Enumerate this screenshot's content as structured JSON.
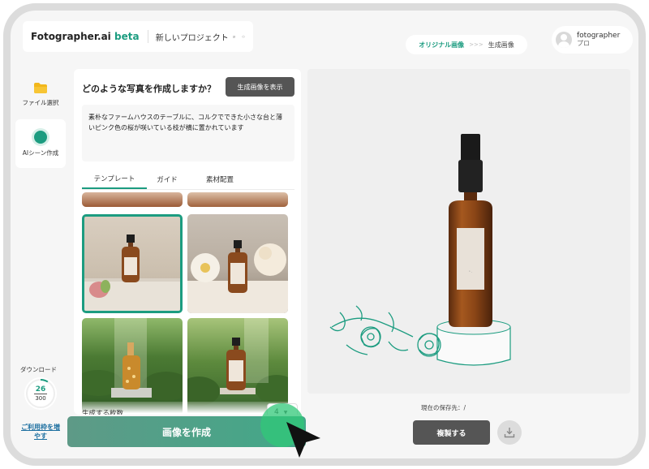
{
  "header": {
    "brand_name": "Fotographer.ai",
    "brand_tag": "beta",
    "project_name": "新しいプロジェクト",
    "view_toggle": {
      "original_label": "オリジナル画像",
      "generated_label": "生成画像"
    },
    "user": {
      "name": "fotographer",
      "plan": "プロ"
    }
  },
  "sidebar": {
    "items": [
      {
        "label": "ファイル選択",
        "icon": "folder-icon"
      },
      {
        "label": "AIシーン作成",
        "icon": "ai-scene-icon"
      }
    ],
    "download": {
      "label": "ダウンロード",
      "remaining": "26",
      "total": "300",
      "fraction": 0.087
    },
    "plan_link": "ご利用枠を増やす"
  },
  "panel": {
    "question": "どのような写真を作成しますか？",
    "show_generated_button": "生成画像を表示",
    "prompt_text": "素朴なファームハウスのテーブルに、コルクでできた小さな台と薄いピンク色の桜が咲いている枝が横に置かれています",
    "tabs": [
      {
        "label": "テンプレート",
        "active": true
      },
      {
        "label": "ガイド",
        "active": false
      },
      {
        "label": "素材配置",
        "active": false
      }
    ],
    "count_label": "生成する枚数",
    "count_value": "4",
    "create_button": "画像を作成"
  },
  "preview": {
    "save_location_label": "現在の保存先：",
    "save_location_value": "/",
    "duplicate_button": "複製する"
  },
  "colors": {
    "accent": "#1c9c80",
    "dark_button": "#555555",
    "create_button": "#4aa588"
  }
}
